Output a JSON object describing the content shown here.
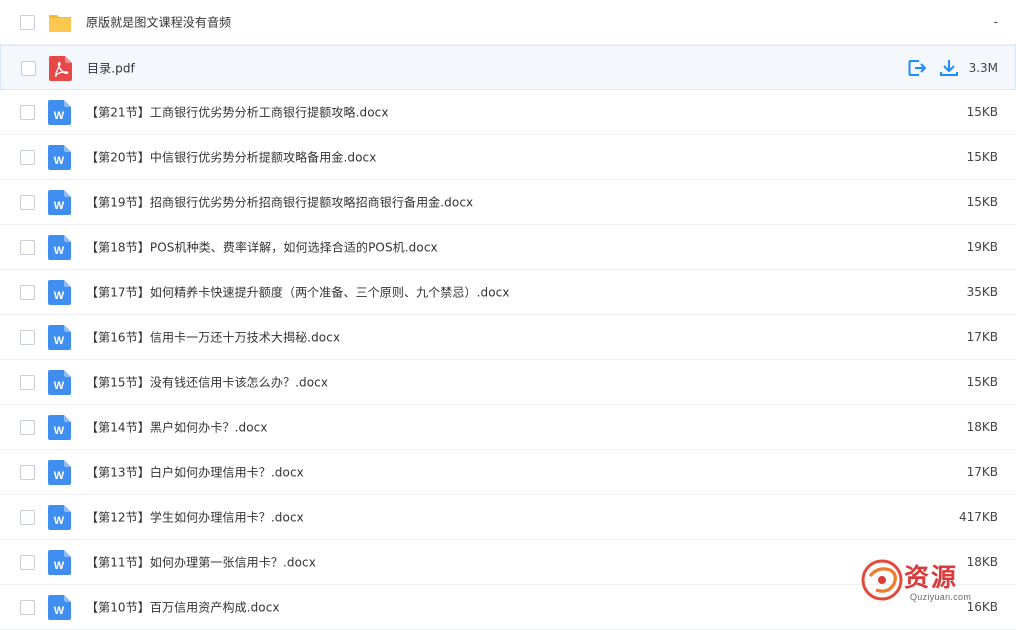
{
  "files": [
    {
      "name": "原版就是图文课程没有音频",
      "size": "-",
      "type": "folder"
    },
    {
      "name": "目录.pdf",
      "size": "3.3M",
      "type": "pdf"
    },
    {
      "name": "【第21节】工商银行优劣势分析工商银行提额攻略.docx",
      "size": "15KB",
      "type": "word"
    },
    {
      "name": "【第20节】中信银行优劣势分析提额攻略备用金.docx",
      "size": "15KB",
      "type": "word"
    },
    {
      "name": "【第19节】招商银行优劣势分析招商银行提额攻略招商银行备用金.docx",
      "size": "15KB",
      "type": "word"
    },
    {
      "name": "【第18节】POS机种类、费率详解，如何选择合适的POS机.docx",
      "size": "19KB",
      "type": "word"
    },
    {
      "name": "【第17节】如何精养卡快速提升额度（两个准备、三个原则、九个禁忌）.docx",
      "size": "35KB",
      "type": "word"
    },
    {
      "name": "【第16节】信用卡一万还十万技术大揭秘.docx",
      "size": "17KB",
      "type": "word"
    },
    {
      "name": "【第15节】没有钱还信用卡该怎么办？.docx",
      "size": "15KB",
      "type": "word"
    },
    {
      "name": "【第14节】黑户如何办卡？.docx",
      "size": "18KB",
      "type": "word"
    },
    {
      "name": "【第13节】白户如何办理信用卡？.docx",
      "size": "17KB",
      "type": "word"
    },
    {
      "name": "【第12节】学生如何办理信用卡？.docx",
      "size": "417KB",
      "type": "word"
    },
    {
      "name": "【第11节】如何办理第一张信用卡？.docx",
      "size": "18KB",
      "type": "word"
    },
    {
      "name": "【第10节】百万信用资产构成.docx",
      "size": "16KB",
      "type": "word"
    }
  ],
  "hover_row_index": 1,
  "icons": {
    "folder": "folder-icon",
    "pdf": "pdf-icon",
    "word": "word-doc-icon",
    "share": "share-icon",
    "download": "download-icon"
  },
  "colors": {
    "accent": "#1e8cff",
    "folder": "#fcc850",
    "pdf": "#e9484b",
    "word": "#3f8ef0",
    "hover_bg": "#f4f8fd"
  },
  "watermark": {
    "title": "资源",
    "subtitle": "Quziyuan.com"
  }
}
